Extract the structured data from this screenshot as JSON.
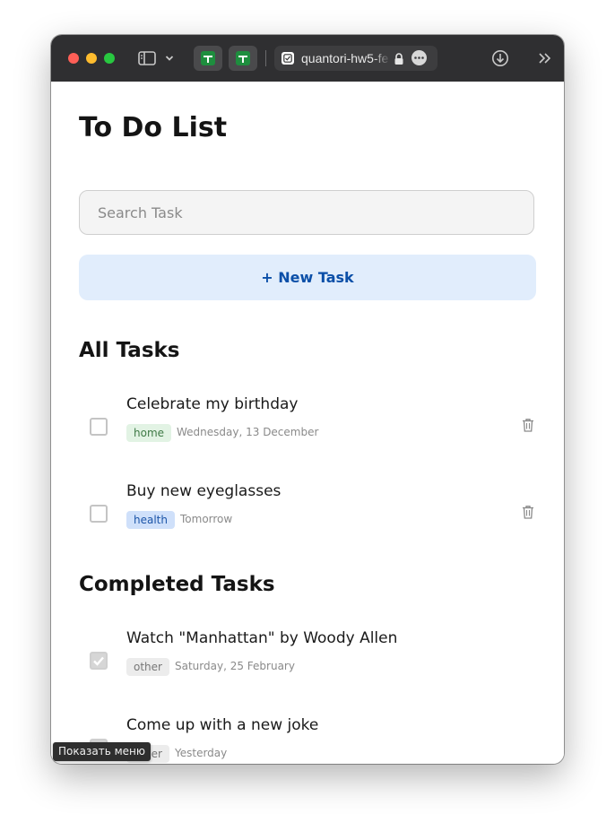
{
  "browser": {
    "url_text": "quantori-hw5-fe",
    "icons": [
      "sidebar-icon",
      "chevron-down-icon",
      "google-sheets-icon",
      "checkbox-favicon-icon",
      "lock-icon",
      "more-icon",
      "download-icon",
      "overflow-chevron-icon"
    ]
  },
  "page": {
    "title": "To Do List"
  },
  "search": {
    "placeholder": "Search Task"
  },
  "new_task_button": {
    "label": "+ New Task",
    "color": "#0b4fa8",
    "background": "#e1edfc"
  },
  "all_tasks": {
    "heading": "All Tasks",
    "items": [
      {
        "title": "Celebrate my birthday",
        "tag": "home",
        "date": "Wednesday, 13 December",
        "completed": false
      },
      {
        "title": "Buy new eyeglasses",
        "tag": "health",
        "date": "Tomorrow",
        "completed": false
      }
    ]
  },
  "completed_tasks": {
    "heading": "Completed Tasks",
    "items": [
      {
        "title": "Watch \"Manhattan\" by Woody Allen",
        "tag": "other",
        "date": "Saturday, 25 February",
        "completed": true
      },
      {
        "title": "Come up with a new joke",
        "tag": "other",
        "date": "Yesterday",
        "completed": true
      }
    ]
  },
  "tooltip": {
    "text": "Показать меню"
  },
  "tag_colors": {
    "home": "#e2f3e4",
    "health": "#cfe0fa",
    "other": "#ececec"
  }
}
